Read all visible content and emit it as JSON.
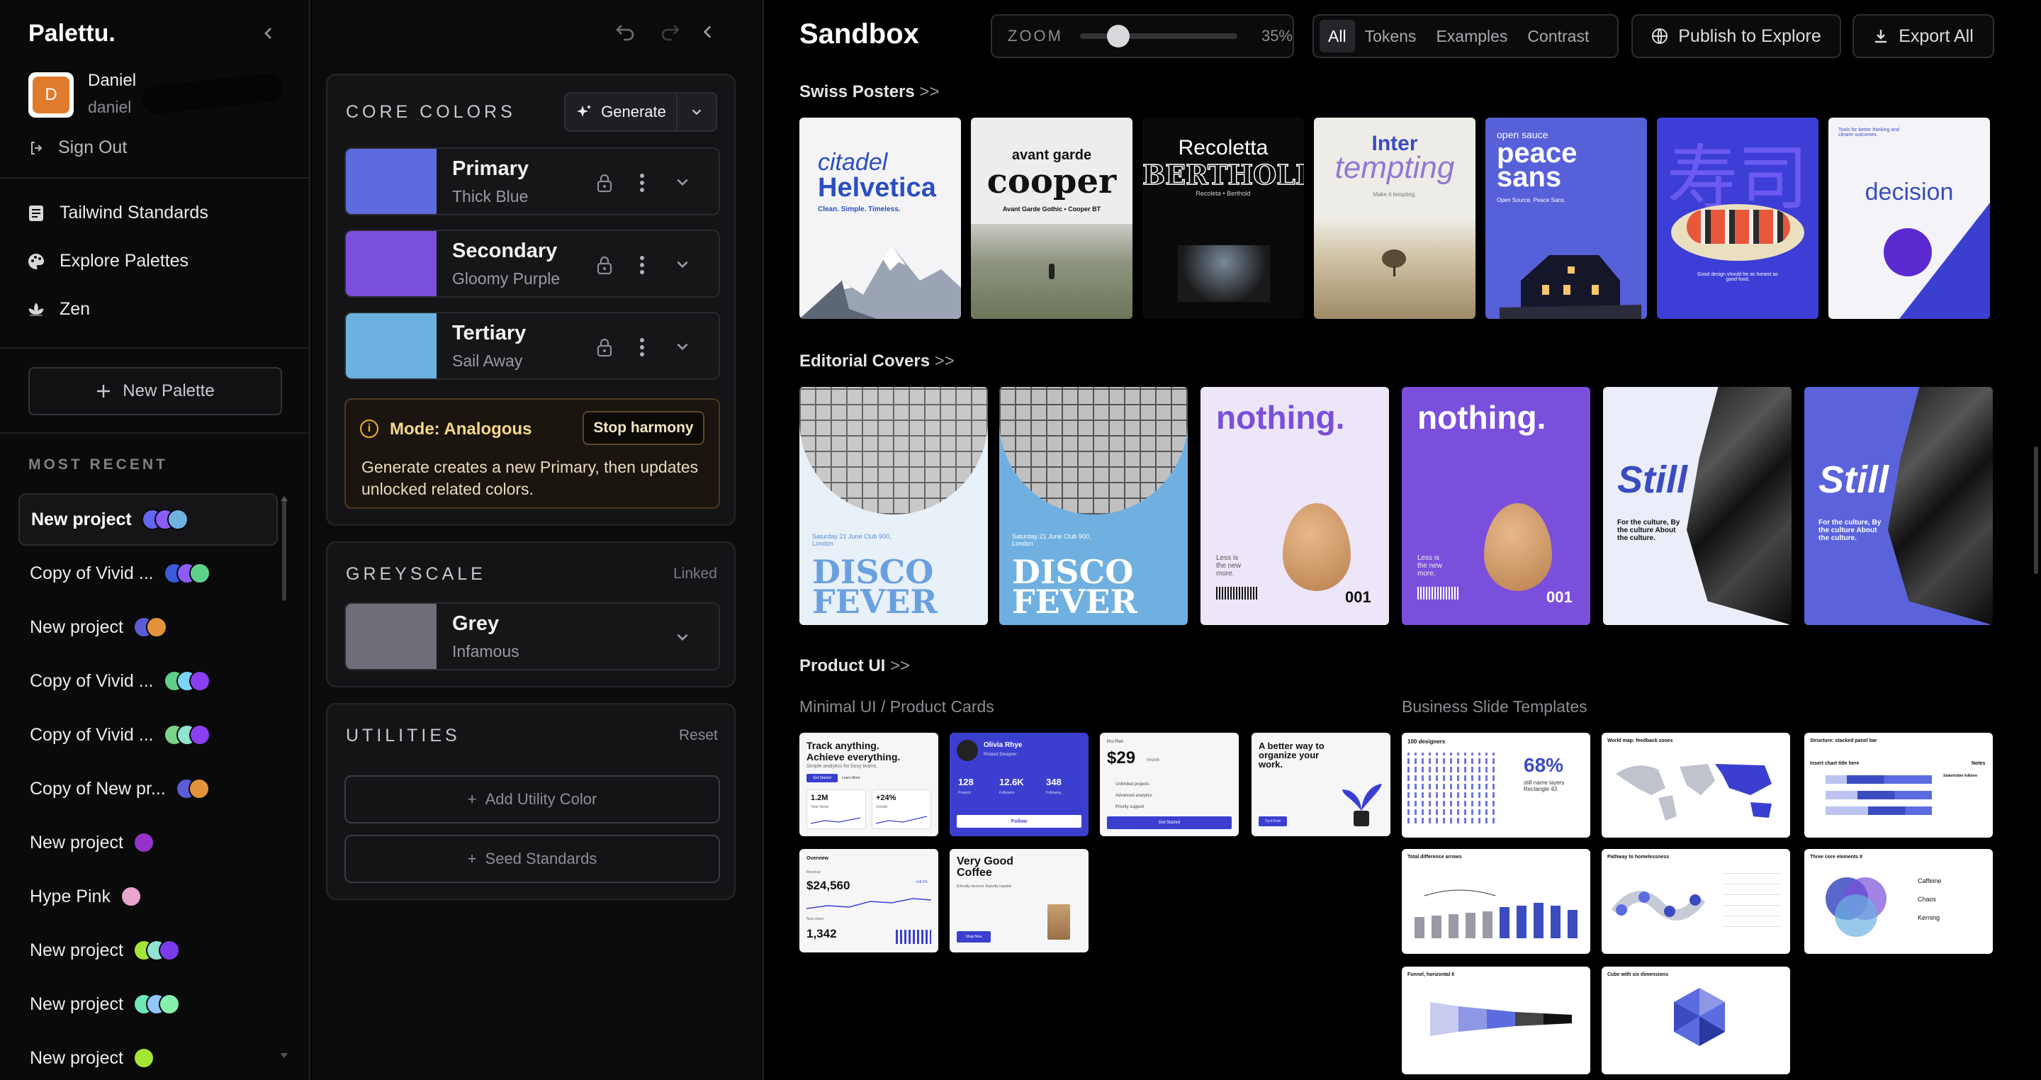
{
  "app": {
    "logo": "Palettu."
  },
  "user": {
    "initial": "D",
    "name": "Daniel",
    "handle": "daniel",
    "sign_out": "Sign Out"
  },
  "nav": [
    {
      "label": "Tailwind Standards",
      "icon": "document-icon"
    },
    {
      "label": "Explore Palettes",
      "icon": "palette-icon"
    },
    {
      "label": "Zen",
      "icon": "lotus-icon"
    }
  ],
  "new_palette": "New Palette",
  "most_recent_label": "MOST RECENT",
  "recent": [
    {
      "label": "New project",
      "colors": [
        "#6366f1",
        "#8b5cf6",
        "#6eb3e0"
      ]
    },
    {
      "label": "Copy of Vivid ...",
      "colors": [
        "#3b5bdb",
        "#8b5cf6",
        "#5fd08c"
      ]
    },
    {
      "label": "New project",
      "colors": [
        "#5b5bd6",
        "#e2923a"
      ]
    },
    {
      "label": "Copy of Vivid ...",
      "colors": [
        "#5fd08c",
        "#7dd3fc",
        "#8b3ff0"
      ]
    },
    {
      "label": "Copy of Vivid ...",
      "colors": [
        "#7bd389",
        "#8fe3d0",
        "#8b3ff0"
      ]
    },
    {
      "label": "Copy of New pr...",
      "colors": [
        "#5b5bd6",
        "#e2923a"
      ]
    },
    {
      "label": "New project",
      "colors": [
        "#9333c9"
      ]
    },
    {
      "label": "Hype Pink",
      "colors": [
        "#e9a4cf"
      ]
    },
    {
      "label": "New project",
      "colors": [
        "#a3e635",
        "#8fe3d0",
        "#7c3aed"
      ]
    },
    {
      "label": "New project",
      "colors": [
        "#6ee7b7",
        "#93c5fd",
        "#86efac"
      ]
    },
    {
      "label": "New project",
      "colors": [
        "#a3e635"
      ]
    }
  ],
  "panel": {
    "core_title": "CORE COLORS",
    "generate": "Generate",
    "colors": [
      {
        "name": "Primary",
        "sub": "Thick Blue",
        "hex": "#5d6bde"
      },
      {
        "name": "Secondary",
        "sub": "Gloomy Purple",
        "hex": "#7a4fdc"
      },
      {
        "name": "Tertiary",
        "sub": "Sail Away",
        "hex": "#6cb2e1"
      }
    ],
    "mode_title": "Mode: Analogous",
    "stop_harmony": "Stop harmony",
    "mode_desc": "Generate creates a new Primary, then updates unlocked related colors.",
    "grey_title": "GREYSCALE",
    "grey_status": "Linked",
    "grey": {
      "name": "Grey",
      "sub": "Infamous",
      "hex": "#6e6e78"
    },
    "util_title": "UTILITIES",
    "util_reset": "Reset",
    "add_utility": "Add Utility Color",
    "seed_standards": "Seed Standards"
  },
  "main": {
    "title": "Sandbox",
    "zoom_label": "ZOOM",
    "zoom_value": "35%",
    "zoom_fraction": 0.2,
    "filters": [
      "All",
      "Tokens",
      "Examples",
      "Contrast"
    ],
    "publish": "Publish to Explore",
    "export": "Export All",
    "sec1": "Swiss Posters",
    "sec2": "Editorial Covers",
    "sec3": "Product UI",
    "arrow": ">>",
    "sub_left": "Minimal UI / Product Cards",
    "sub_right": "Business Slide Templates"
  },
  "posters": {
    "p1a": "citadel",
    "p1b": "Helvetica",
    "p1c": "Clean. Simple. Timeless.",
    "p2a": "avant garde",
    "p2b": "cooper",
    "p2c": "Avant Garde Gothic • Cooper BT",
    "p3a": "Recoletta",
    "p3b": "BERTHOLD",
    "p3c": "Recoleta • Berthold",
    "p4a": "Inter",
    "p4b": "tempting",
    "p4c": "Make it tempting.",
    "p5a": "open sauce",
    "p5b": "peace",
    "p5c": "sans",
    "p5d": "Open Source. Peace Sans.",
    "p6a": "寿司",
    "p6b": "Good design should be as honest as good food.",
    "p8a": "Tools for better thinking and clearer outcomes.",
    "p8b": "decision"
  },
  "covers": {
    "disco1": "DISCO",
    "disco2": "FEVER",
    "disco_meta": "Saturday 21 June Club 900, London",
    "nothing": "nothing.",
    "less": "Less is the new more.",
    "num": "001",
    "still": "Still",
    "still_sub": "For the culture, By the culture About the culture."
  },
  "cards": {
    "c1a": "Track anything.",
    "c1b": "Achieve everything.",
    "c1c": "Simple analytics for busy teams.",
    "c1d": "Get Started",
    "c1e": "Learn More",
    "c1f": "1.2M",
    "c1g": "+24%",
    "c1h": "Total Views",
    "c1i": "Growth",
    "c2a": "Olivia Rhye",
    "c2b": "Product Designer",
    "c2c": "128",
    "c2d": "12.6K",
    "c2e": "348",
    "c2f": "Projects",
    "c2g": "Followers",
    "c2h": "Following",
    "c2i": "Follow",
    "c3a": "Pro Plan",
    "c3b": "$29",
    "c3c": "/month",
    "c3d": "Unlimited projects",
    "c3e": "Advanced analytics",
    "c3f": "Priority support",
    "c3g": "Get Started",
    "c4a": "A better way to organize your work.",
    "c4b": "Try it Free",
    "c5a": "Overview",
    "c5b": "Revenue",
    "c5c": "$24,560",
    "c5d": "+18.2%",
    "c5e": "New Users",
    "c5f": "1,342",
    "c6a": "Very Good Coffee",
    "c6b": "Ethically sourced. Expertly roasted.",
    "c6c": "Shop Now"
  },
  "slides": {
    "s1a": "100 designers",
    "s1b": "68%",
    "s1c": "still name layers Rectangle 43",
    "s2a": "World map: feedback zones",
    "s3a": "Structure: stacked panel bar",
    "s3b": "Insert chart title here",
    "s3c": "Notes",
    "s3d": "Stakeholder folklore",
    "s4a": "Total difference arrows",
    "s5a": "Pathway to homelessness",
    "s6a": "Three core elements II",
    "s6b": "Caffeine",
    "s6c": "Chaos",
    "s6d": "Kerning",
    "s7a": "Funnel, horizontal II",
    "s8a": "Cube with six dimensions"
  }
}
